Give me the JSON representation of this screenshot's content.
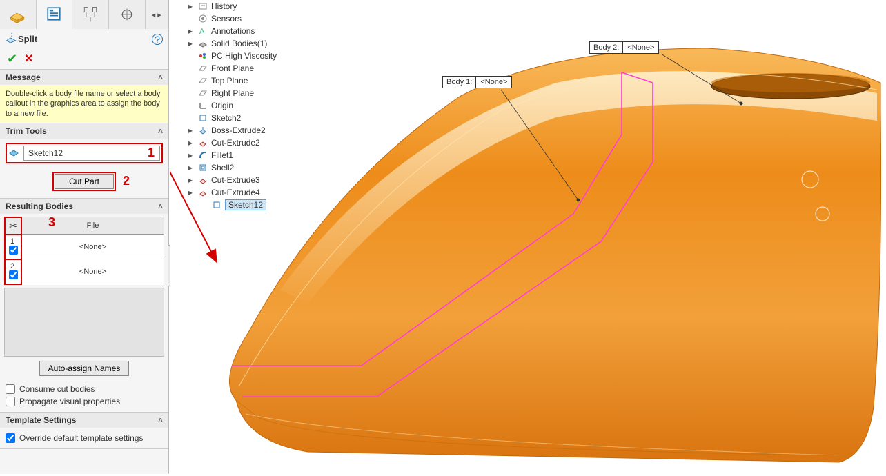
{
  "feature": {
    "name": "Split",
    "help_tooltip": "?"
  },
  "message_section": {
    "title": "Message",
    "text": "Double-click a body file name or select a body callout in the graphics area to assign the body to a new file."
  },
  "trim_tools": {
    "title": "Trim Tools",
    "selection": "Sketch12",
    "cut_part_label": "Cut Part"
  },
  "resulting_bodies": {
    "title": "Resulting Bodies",
    "file_header": "File",
    "rows": [
      {
        "index": "1",
        "file": "<None>"
      },
      {
        "index": "2",
        "file": "<None>"
      }
    ],
    "auto_assign_label": "Auto-assign Names"
  },
  "options": {
    "consume_label": "Consume cut bodies",
    "propagate_label": "Propagate visual properties"
  },
  "template_settings": {
    "title": "Template Settings",
    "override_label": "Override default template settings"
  },
  "annotations": {
    "n1": "1",
    "n2": "2",
    "n3": "3"
  },
  "tree": [
    {
      "label": "History",
      "expander": "▸",
      "icon": "history"
    },
    {
      "label": "Sensors",
      "expander": "",
      "icon": "sensor"
    },
    {
      "label": "Annotations",
      "expander": "▸",
      "icon": "annot"
    },
    {
      "label": "Solid Bodies(1)",
      "expander": "▸",
      "icon": "solid"
    },
    {
      "label": "PC High Viscosity",
      "expander": "",
      "icon": "material"
    },
    {
      "label": "Front Plane",
      "expander": "",
      "icon": "plane"
    },
    {
      "label": "Top Plane",
      "expander": "",
      "icon": "plane"
    },
    {
      "label": "Right Plane",
      "expander": "",
      "icon": "plane"
    },
    {
      "label": "Origin",
      "expander": "",
      "icon": "origin"
    },
    {
      "label": "Sketch2",
      "expander": "",
      "icon": "sketch"
    },
    {
      "label": "Boss-Extrude2",
      "expander": "▸",
      "icon": "extrude"
    },
    {
      "label": "Cut-Extrude2",
      "expander": "▸",
      "icon": "cutext"
    },
    {
      "label": "Fillet1",
      "expander": "▸",
      "icon": "fillet"
    },
    {
      "label": "Shell2",
      "expander": "▸",
      "icon": "shell"
    },
    {
      "label": "Cut-Extrude3",
      "expander": "▸",
      "icon": "cutext"
    },
    {
      "label": "Cut-Extrude4",
      "expander": "▸",
      "icon": "cutext"
    },
    {
      "label": "Sketch12",
      "expander": "",
      "icon": "sketch",
      "selected": true
    }
  ],
  "callouts": {
    "body1_label": "Body  1:",
    "body1_value": "<None>",
    "body2_label": "Body  2:",
    "body2_value": "<None>"
  },
  "colors": {
    "accent_red": "#d40000",
    "highlight_bg": "#ffffc5",
    "model_orange": "#ed8c1a",
    "model_orange_light": "#f7a73c",
    "sketch_magenta": "#ff3fd4"
  }
}
